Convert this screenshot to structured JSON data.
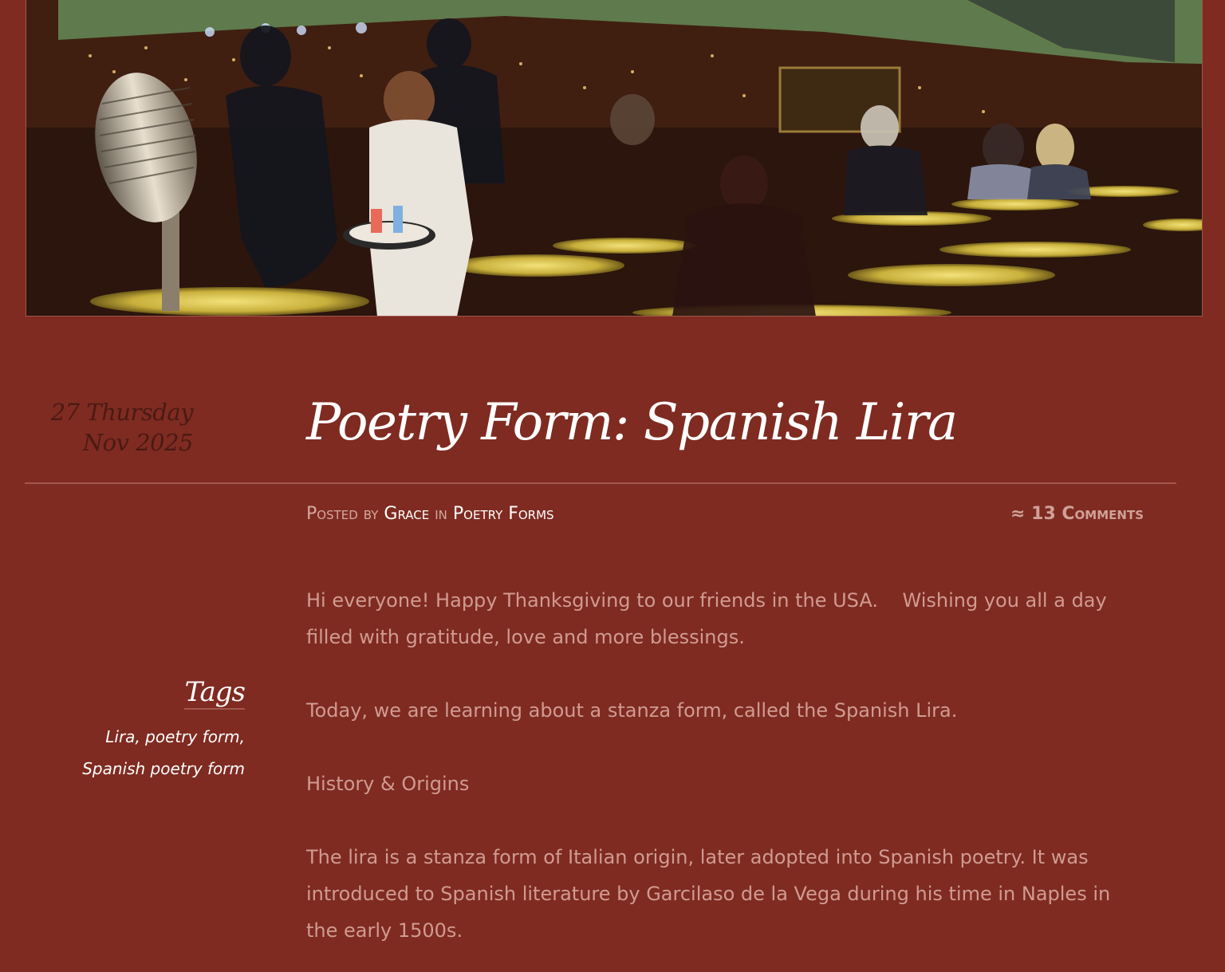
{
  "header": {
    "banner_alt": "Poetry cafe banner"
  },
  "post": {
    "date_line1": "27 Thursday",
    "date_line2": "Nov 2025",
    "title": "Poetry Form: Spanish Lira",
    "meta": {
      "posted_by_label": "Posted by",
      "author": "Grace",
      "in_label": "in",
      "category": "Poetry Forms",
      "comments": "≈ 13 Comments"
    },
    "paragraphs": [
      "Hi everyone! Happy Thanksgiving to our friends in the USA.    Wishing you all a day filled with gratitude, love and more blessings.",
      "Today, we are learning about a stanza form, called the Spanish Lira.",
      "History & Origins",
      "The lira is a stanza form of Italian origin, later adopted into Spanish poetry. It was introduced to Spanish literature by Garcilaso de la Vega during his time in Naples in the early 1500s."
    ]
  },
  "sidebar": {
    "tags_title": "Tags",
    "tags": [
      "Lira",
      "poetry form",
      "Spanish poetry form"
    ]
  }
}
